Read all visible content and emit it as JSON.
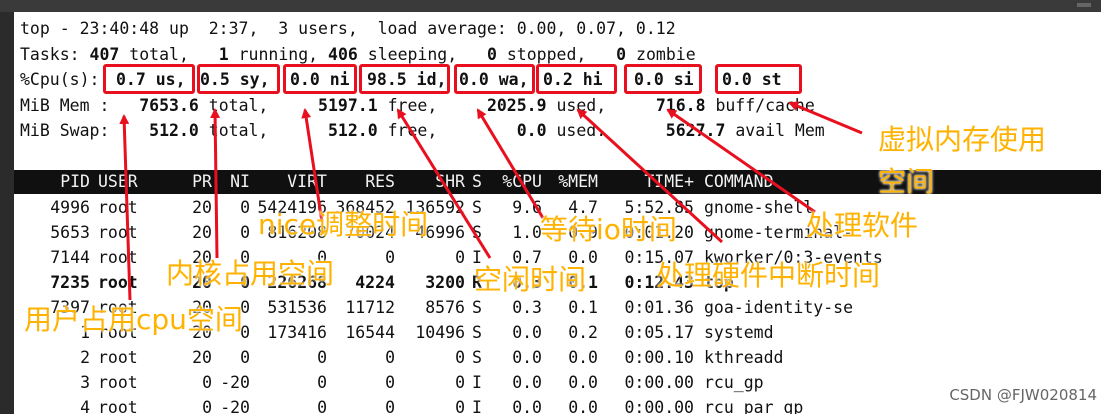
{
  "summary": {
    "uptime_line": "top - 23:40:48 up  2:37,  3 users,  load average: 0.00, 0.07, 0.12",
    "tasks": {
      "label": "Tasks:",
      "total": "407",
      "total_l": "total,",
      "running": "1",
      "running_l": "running,",
      "sleeping": "406",
      "sleeping_l": "sleeping,",
      "stopped": "0",
      "stopped_l": "stopped,",
      "zombie": "0",
      "zombie_l": "zombie"
    },
    "cpu": {
      "label": "%Cpu(s):",
      "us": "0.7 us,",
      "sy": "0.5 sy,",
      "ni": "0.0 ni",
      "id": "98.5 id,",
      "wa": "0.0 wa,",
      "hi": "0.2 hi",
      "si": "0.0 si",
      "st": "0.0 st"
    },
    "mem": {
      "label": "MiB Mem :",
      "total": "7653.6",
      "total_l": "total,",
      "free": "5197.1",
      "free_l": "free,",
      "used": "2025.9",
      "used_l": "used,",
      "cache": "716.8",
      "cache_l": "buff/cache"
    },
    "swap": {
      "label": "MiB Swap:",
      "total": "512.0",
      "total_l": "total,",
      "free": "512.0",
      "free_l": "free,",
      "used": "0.0",
      "used_l": "used.",
      "avail": "5627.7",
      "avail_l": "avail Mem"
    }
  },
  "columns": [
    "PID",
    "USER",
    "PR",
    "NI",
    "VIRT",
    "RES",
    "SHR",
    "S",
    "%CPU",
    "%MEM",
    "TIME+",
    "COMMAND"
  ],
  "processes": [
    {
      "pid": "4996",
      "user": "root",
      "pr": "20",
      "ni": "0",
      "virt": "5424196",
      "res": "368452",
      "shr": "136592",
      "s": "S",
      "cpu": "9.6",
      "mem": "4.7",
      "time": "5:52.85",
      "cmd": "gnome-shell"
    },
    {
      "pid": "5653",
      "user": "root",
      "pr": "20",
      "ni": "0",
      "virt": "816208",
      "res": "70024",
      "shr": "46996",
      "s": "S",
      "cpu": "1.0",
      "mem": "0.9",
      "time": "0:01.20",
      "cmd": "gnome-terminal-"
    },
    {
      "pid": "7144",
      "user": "root",
      "pr": "20",
      "ni": "0",
      "virt": "0",
      "res": "0",
      "shr": "0",
      "s": "I",
      "cpu": "0.7",
      "mem": "0.0",
      "time": "0:15.07",
      "cmd": "kworker/0:3-events"
    },
    {
      "pid": "7235",
      "user": "root",
      "pr": "20",
      "ni": "0",
      "virt": "226268",
      "res": "4224",
      "shr": "3200",
      "s": "R",
      "cpu": "0.3",
      "mem": "0.1",
      "time": "0:12.43",
      "cmd": "top"
    },
    {
      "pid": "7397",
      "user": "root",
      "pr": "20",
      "ni": "0",
      "virt": "531536",
      "res": "11712",
      "shr": "8576",
      "s": "S",
      "cpu": "0.3",
      "mem": "0.1",
      "time": "0:01.36",
      "cmd": "goa-identity-se"
    },
    {
      "pid": "1",
      "user": "root",
      "pr": "20",
      "ni": "0",
      "virt": "173416",
      "res": "16544",
      "shr": "10496",
      "s": "S",
      "cpu": "0.0",
      "mem": "0.2",
      "time": "0:05.17",
      "cmd": "systemd"
    },
    {
      "pid": "2",
      "user": "root",
      "pr": "20",
      "ni": "0",
      "virt": "0",
      "res": "0",
      "shr": "0",
      "s": "S",
      "cpu": "0.0",
      "mem": "0.0",
      "time": "0:00.10",
      "cmd": "kthreadd"
    },
    {
      "pid": "3",
      "user": "root",
      "pr": "0",
      "ni": "-20",
      "virt": "0",
      "res": "0",
      "shr": "0",
      "s": "I",
      "cpu": "0.0",
      "mem": "0.0",
      "time": "0:00.00",
      "cmd": "rcu_gp"
    },
    {
      "pid": "4",
      "user": "root",
      "pr": "0",
      "ni": "-20",
      "virt": "0",
      "res": "0",
      "shr": "0",
      "s": "I",
      "cpu": "0.0",
      "mem": "0.0",
      "time": "0:00.00",
      "cmd": "rcu_par_gp"
    }
  ],
  "annotations": {
    "us": "用户占用cpu空间",
    "sy": "内核占用空间",
    "ni": "nice调整时间",
    "id": "空闲时间",
    "wa": "等待io时间",
    "hi": "处理硬件中断时间",
    "si": "处理软件",
    "st_line1": "虚拟内存使用",
    "st_line2": "空间"
  },
  "watermark": "CSDN @FJW020814",
  "colors": {
    "annotation": "#ffb200",
    "box": "#e8101e",
    "header_bg": "#101010"
  }
}
